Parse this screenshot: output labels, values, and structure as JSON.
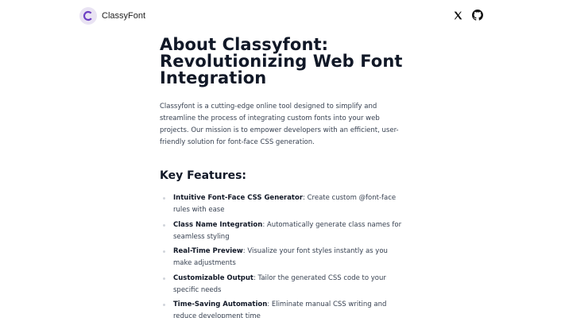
{
  "header": {
    "brand_name": "ClassyFont",
    "logo_icon": "classyfont-logo-icon",
    "social": [
      {
        "name": "x-icon"
      },
      {
        "name": "github-icon"
      }
    ]
  },
  "main": {
    "title_lines": [
      "About Classyfont:",
      "Revolutionizing Web Font",
      "Integration"
    ],
    "intro": "Classyfont is a cutting-edge online tool designed to simplify and streamline the process of integrating custom fonts into your web projects. Our mission is to empower developers with an efficient, user-friendly solution for font-face CSS generation.",
    "features_heading": "Key Features:",
    "features": [
      {
        "name": "Intuitive Font-Face CSS Generator",
        "desc": ": Create custom @font-face rules with ease"
      },
      {
        "name": "Class Name Integration",
        "desc": ": Automatically generate class names for seamless styling"
      },
      {
        "name": "Real-Time Preview",
        "desc": ": Visualize your font styles instantly as you make adjustments"
      },
      {
        "name": "Customizable Output",
        "desc": ": Tailor the generated CSS code to your specific needs"
      },
      {
        "name": "Time-Saving Automation",
        "desc": ": Eliminate manual CSS writing and reduce development time"
      }
    ]
  },
  "colors": {
    "text": "#1f2937",
    "heading": "#111827",
    "logo_bg": "#e9e3f3",
    "logo_accent": "#6d3fc4"
  }
}
